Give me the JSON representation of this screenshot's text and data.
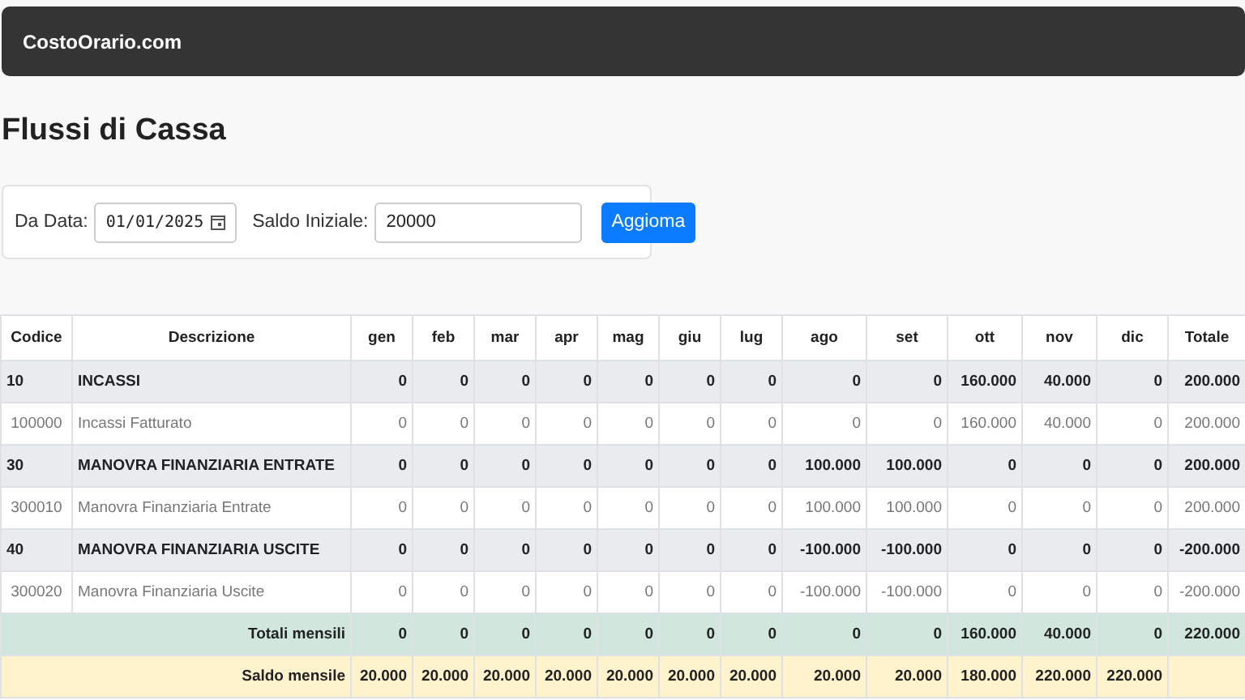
{
  "navbar": {
    "brand": "CostoOrario.com"
  },
  "title": "Flussi di Cassa",
  "filters": {
    "date_label": "Da Data:",
    "date_value": "01/01/2025",
    "balance_label": "Saldo Iniziale:",
    "balance_value": "20000",
    "button": "Aggioma"
  },
  "table": {
    "columns": [
      "Codice",
      "Descrizione",
      "gen",
      "feb",
      "mar",
      "apr",
      "mag",
      "giu",
      "lug",
      "ago",
      "set",
      "ott",
      "nov",
      "dic",
      "Totale"
    ],
    "rows": [
      {
        "kind": "group",
        "code": "10",
        "description": "INCASSI",
        "values": [
          "0",
          "0",
          "0",
          "0",
          "0",
          "0",
          "0",
          "0",
          "0",
          "160.000",
          "40.000",
          "0",
          "200.000"
        ]
      },
      {
        "kind": "item",
        "code": "100000",
        "description": "Incassi Fatturato",
        "values": [
          "0",
          "0",
          "0",
          "0",
          "0",
          "0",
          "0",
          "0",
          "0",
          "160.000",
          "40.000",
          "0",
          "200.000"
        ]
      },
      {
        "kind": "group",
        "code": "30",
        "description": "MANOVRA FINANZIARIA ENTRATE",
        "values": [
          "0",
          "0",
          "0",
          "0",
          "0",
          "0",
          "0",
          "100.000",
          "100.000",
          "0",
          "0",
          "0",
          "200.000"
        ]
      },
      {
        "kind": "item",
        "code": "300010",
        "description": "Manovra Finanziaria Entrate",
        "values": [
          "0",
          "0",
          "0",
          "0",
          "0",
          "0",
          "0",
          "100.000",
          "100.000",
          "0",
          "0",
          "0",
          "200.000"
        ]
      },
      {
        "kind": "group",
        "code": "40",
        "description": "MANOVRA FINANZIARIA USCITE",
        "values": [
          "0",
          "0",
          "0",
          "0",
          "0",
          "0",
          "0",
          "-100.000",
          "-100.000",
          "0",
          "0",
          "0",
          "-200.000"
        ]
      },
      {
        "kind": "item",
        "code": "300020",
        "description": "Manovra Finanziaria Uscite",
        "values": [
          "0",
          "0",
          "0",
          "0",
          "0",
          "0",
          "0",
          "-100.000",
          "-100.000",
          "0",
          "0",
          "0",
          "-200.000"
        ]
      },
      {
        "kind": "totals",
        "label": "Totali mensili",
        "values": [
          "0",
          "0",
          "0",
          "0",
          "0",
          "0",
          "0",
          "0",
          "0",
          "160.000",
          "40.000",
          "0",
          "220.000"
        ]
      },
      {
        "kind": "balance",
        "label": "Saldo mensile",
        "values": [
          "20.000",
          "20.000",
          "20.000",
          "20.000",
          "20.000",
          "20.000",
          "20.000",
          "20.000",
          "20.000",
          "180.000",
          "220.000",
          "220.000"
        ]
      }
    ]
  }
}
